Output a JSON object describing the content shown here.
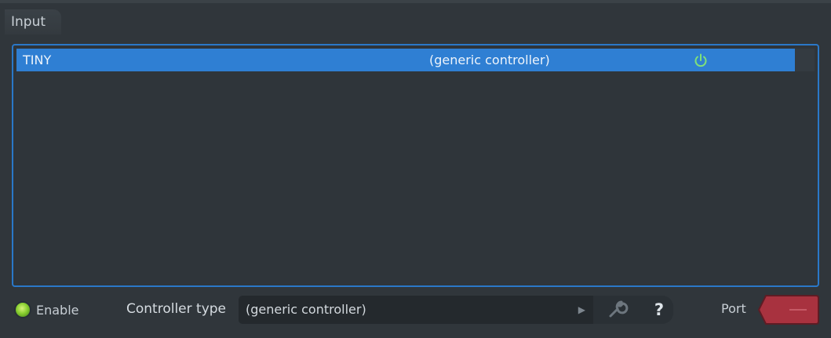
{
  "tab": {
    "label": "Input"
  },
  "devices": [
    {
      "name": "TINY",
      "controller": "(generic controller)",
      "enabled": true
    }
  ],
  "bottom": {
    "enable_label": "Enable",
    "controller_type_label": "Controller type",
    "controller_type_value": "(generic controller)",
    "help_label": "?",
    "port_label": "Port"
  },
  "colors": {
    "selection": "#2f7fd3",
    "focus_border": "#2a78c8",
    "led_on": "#8ad031",
    "port_red": "#a8323f"
  }
}
